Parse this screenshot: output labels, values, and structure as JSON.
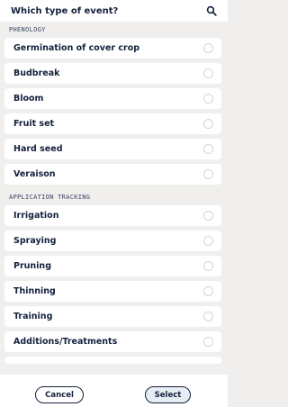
{
  "header": {
    "title": "Which type of event?",
    "search_icon": "search-icon"
  },
  "sections": [
    {
      "label": "PHENOLOGY",
      "items": [
        "Germination of cover crop",
        "Budbreak",
        "Bloom",
        "Fruit set",
        "Hard seed",
        "Veraison"
      ]
    },
    {
      "label": "APPLICATION TRACKING",
      "items": [
        "Irrigation",
        "Spraying",
        "Pruning",
        "Thinning",
        "Training",
        "Additions/Treatments"
      ]
    }
  ],
  "footer": {
    "cancel_label": "Cancel",
    "select_label": "Select"
  },
  "colors": {
    "background": "#f1efed",
    "text": "#14213d",
    "select_bg": "#e6edf3"
  }
}
